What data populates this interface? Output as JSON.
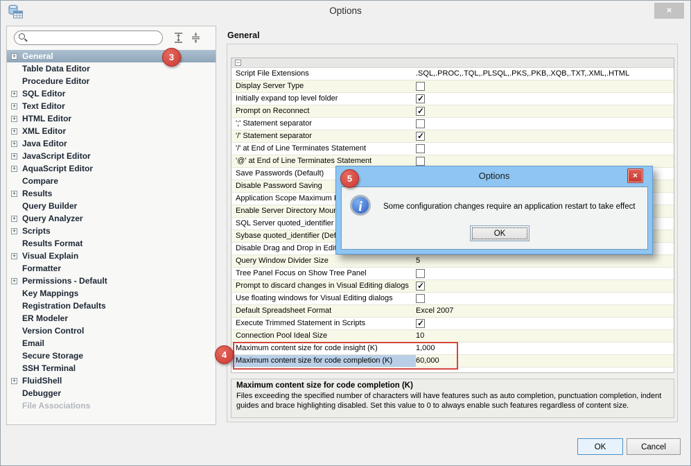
{
  "window": {
    "title": "Options",
    "close_label": "×"
  },
  "colors": {
    "annotation_red": "#d5453c",
    "row_cream": "#f8f8e8",
    "label_highlight_blue": "#b9cfe8",
    "tree_selection_blue": "#9fb4c7",
    "dialog_frame_blue": "#8ec5f2",
    "ok_button_blue": "#e7f2fc"
  },
  "sidebar": {
    "search": {
      "value": "",
      "placeholder": ""
    },
    "items": [
      {
        "label": "General",
        "expandable": true,
        "selected": true,
        "badge": "3"
      },
      {
        "label": "Table Data Editor"
      },
      {
        "label": "Procedure Editor"
      },
      {
        "label": "SQL Editor",
        "expandable": true
      },
      {
        "label": "Text Editor",
        "expandable": true
      },
      {
        "label": "HTML Editor",
        "expandable": true
      },
      {
        "label": "XML Editor",
        "expandable": true
      },
      {
        "label": "Java Editor",
        "expandable": true
      },
      {
        "label": "JavaScript Editor",
        "expandable": true
      },
      {
        "label": "AquaScript Editor",
        "expandable": true
      },
      {
        "label": "Compare"
      },
      {
        "label": "Results",
        "expandable": true
      },
      {
        "label": "Query Builder"
      },
      {
        "label": "Query Analyzer",
        "expandable": true
      },
      {
        "label": "Scripts",
        "expandable": true
      },
      {
        "label": "Results Format"
      },
      {
        "label": "Visual Explain",
        "expandable": true
      },
      {
        "label": "Formatter"
      },
      {
        "label": "Permissions - Default",
        "expandable": true
      },
      {
        "label": "Key Mappings"
      },
      {
        "label": "Registration Defaults"
      },
      {
        "label": "ER Modeler"
      },
      {
        "label": "Version Control"
      },
      {
        "label": "Email"
      },
      {
        "label": "Secure Storage"
      },
      {
        "label": "SSH Terminal"
      },
      {
        "label": "FluidShell",
        "expandable": true
      },
      {
        "label": "Debugger"
      },
      {
        "label": "File Associations",
        "disabled": true
      }
    ]
  },
  "main": {
    "header": "General",
    "rows": [
      {
        "label": "Script File Extensions",
        "type": "text",
        "value": ".SQL,.PROC,.TQL,.PLSQL,.PKS,.PKB,.XQB,.TXT,.XML,.HTML"
      },
      {
        "label": "Display Server Type",
        "type": "checkbox",
        "checked": false
      },
      {
        "label": "Initially expand top level folder",
        "type": "checkbox",
        "checked": true
      },
      {
        "label": "Prompt on Reconnect",
        "type": "checkbox",
        "checked": true
      },
      {
        "label": "';' Statement separator",
        "type": "checkbox",
        "checked": false
      },
      {
        "label": "'/' Statement separator",
        "type": "checkbox",
        "checked": true
      },
      {
        "label": "'/' at End of Line Terminates Statement",
        "type": "checkbox",
        "checked": false
      },
      {
        "label": "'@' at End of Line Terminates Statement",
        "type": "checkbox",
        "checked": false
      },
      {
        "label": "Save Passwords (Default)",
        "type": "none"
      },
      {
        "label": "Disable Password Saving",
        "type": "none"
      },
      {
        "label": "Application Scope Maximum Re",
        "type": "none"
      },
      {
        "label": "Enable Server Directory Moun",
        "type": "none"
      },
      {
        "label": "SQL Server quoted_identifier",
        "type": "none"
      },
      {
        "label": "Sybase quoted_identifier (Def",
        "type": "none"
      },
      {
        "label": "Disable Drag and Drop in Edito",
        "type": "none"
      },
      {
        "label": "Query Window Divider Size",
        "type": "text",
        "value": "5"
      },
      {
        "label": "Tree Panel Focus on Show Tree Panel",
        "type": "checkbox",
        "checked": false
      },
      {
        "label": "Prompt to discard changes in Visual Editing dialogs",
        "type": "checkbox",
        "checked": true
      },
      {
        "label": "Use floating windows for Visual Editing dialogs",
        "type": "checkbox",
        "checked": false
      },
      {
        "label": "Default Spreadsheet Format",
        "type": "text",
        "value": "Excel 2007"
      },
      {
        "label": "Execute Trimmed Statement in Scripts",
        "type": "checkbox",
        "checked": true
      },
      {
        "label": "Connection Pool Ideal Size",
        "type": "text",
        "value": "10"
      },
      {
        "label": "Maximum content size for code insight (K)",
        "type": "text",
        "value": "1,000"
      },
      {
        "label": "Maximum content size for code completion (K)",
        "type": "text",
        "value": "60,000",
        "highlighted": true
      }
    ],
    "description": {
      "title": "Maximum content size for code completion (K)",
      "body": "Files exceeding the specified number of characters will have features such as auto completion, punctuation completion, indent guides and brace highlighting disabled. Set this value to 0 to always enable such features regardless of content size."
    },
    "buttons": {
      "ok": "OK",
      "cancel": "Cancel"
    }
  },
  "modal": {
    "title": "Options",
    "message": "Some configuration changes require an application restart to take effect",
    "ok_label": "OK",
    "close_label": "×"
  },
  "annotations": {
    "badge3": "3",
    "badge4": "4",
    "badge5": "5"
  }
}
